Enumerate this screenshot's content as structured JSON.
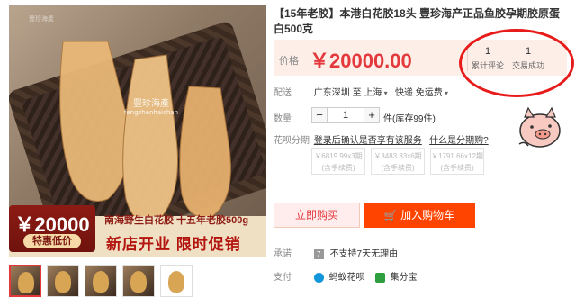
{
  "image": {
    "watermark_cn": "豐珍海產",
    "watermark_en": "fengzhenhaichan",
    "watermark_small": "豐珍海產",
    "tag_price": "￥20000",
    "tag_sub": "特惠低价",
    "slogan1": "南海野生白花胶 十五年老胶500g",
    "slogan2": "新店开业 限时促销"
  },
  "title": "【15年老胶】本港白花胶18头 豐珍海产正品鱼胶孕期胶原蛋白500克",
  "price": {
    "label": "价格",
    "value": "￥20000.00"
  },
  "stats": [
    {
      "num": "1",
      "label": "累计评论"
    },
    {
      "num": "1",
      "label": "交易成功"
    }
  ],
  "shipping": {
    "label": "配送",
    "from": "广东深圳",
    "to_prefix": "至",
    "to": "上海",
    "method": "快递 免运费"
  },
  "quantity": {
    "label": "数量",
    "minus": "−",
    "value": "1",
    "plus": "+",
    "stock": "件(库存99件)"
  },
  "huabei": {
    "label": "花呗分期",
    "link1": "登录后确认是否享有该服务",
    "link2": "什么是分期购?",
    "options": [
      {
        "price": "￥6819.99x3期",
        "note": "(含手续费)"
      },
      {
        "price": "￥3483.33x6期",
        "note": "(含手续费)"
      },
      {
        "price": "￥1791.66x12期",
        "note": "(含手续费)"
      }
    ]
  },
  "buttons": {
    "buy_now": "立即购买",
    "add_cart": "加入购物车"
  },
  "promise": {
    "label": "承诺",
    "icon_text": "7",
    "text": "不支持7天无理由"
  },
  "payment": {
    "label": "支付",
    "methods": [
      "蚂蚁花呗",
      "集分宝"
    ]
  },
  "colors": {
    "accent": "#e4393c",
    "cart": "#ff4400",
    "annotation_circle": "#e81b1b"
  }
}
